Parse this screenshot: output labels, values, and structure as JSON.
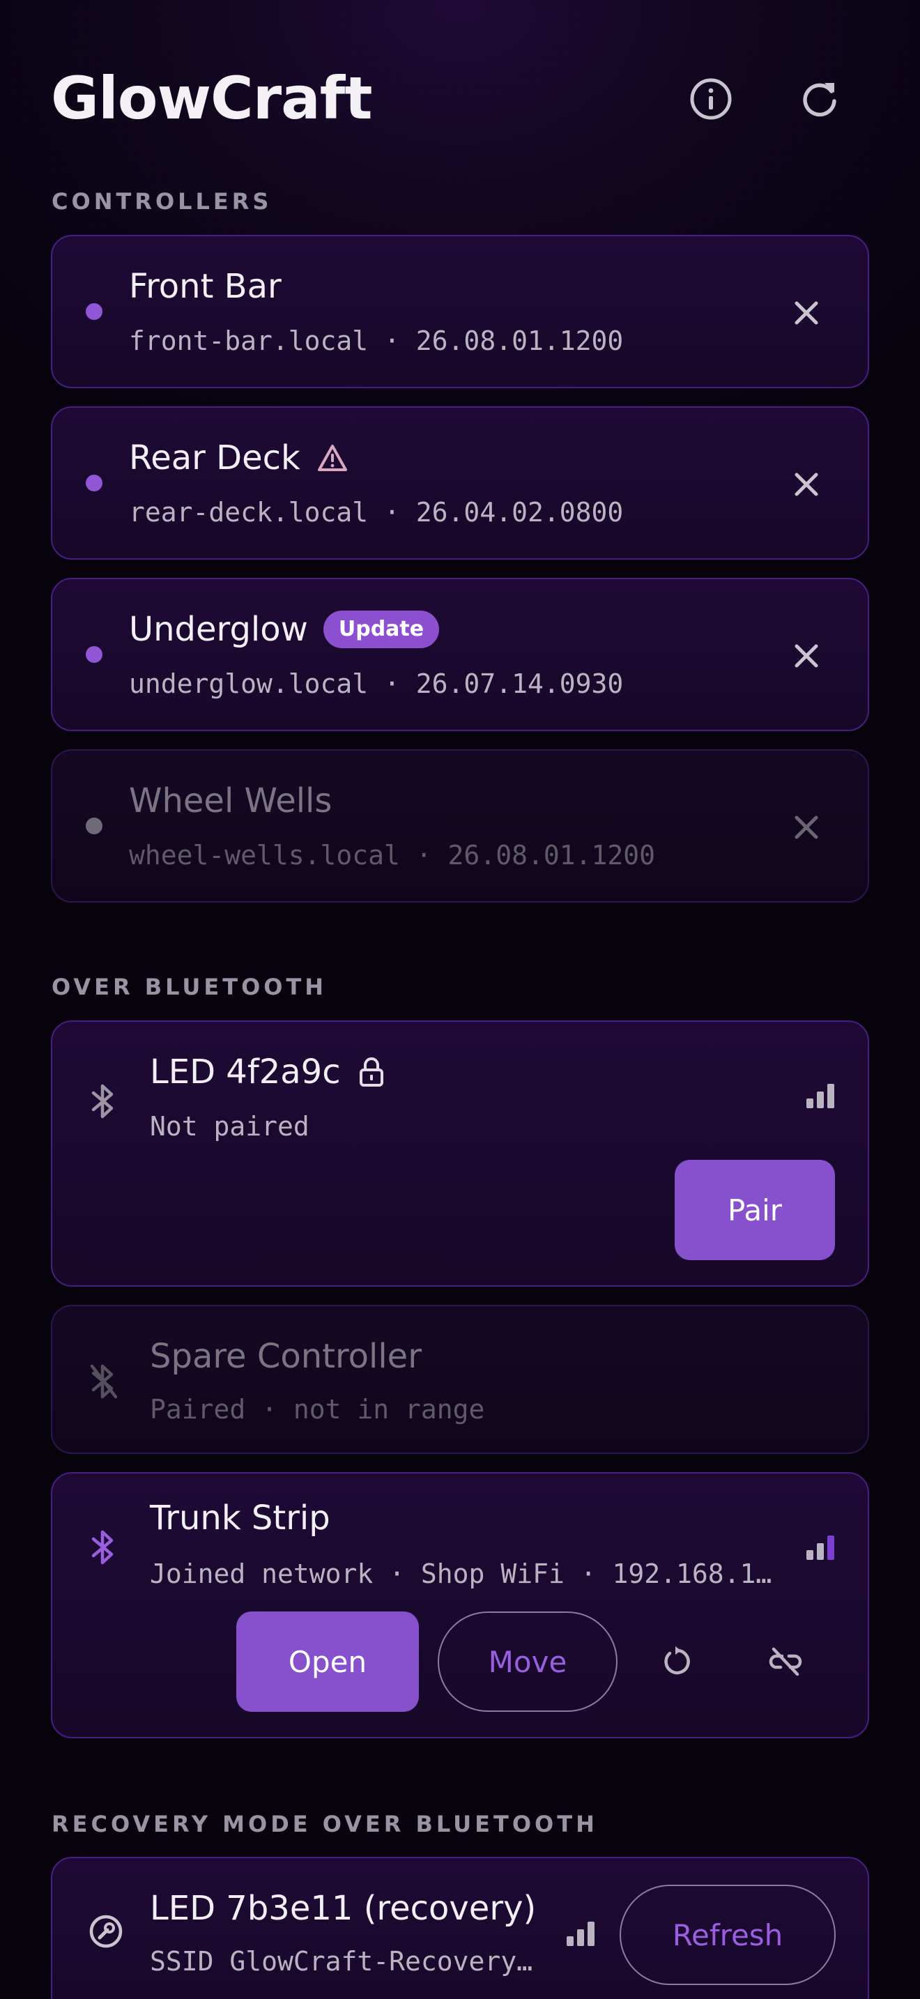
{
  "app": {
    "title": "GlowCraft"
  },
  "header": {
    "info_icon": "info-icon",
    "refresh_icon": "refresh-icon"
  },
  "sections": {
    "controllers": "CONTROLLERS",
    "bluetooth": "OVER BLUETOOTH",
    "recovery": "RECOVERY MODE OVER BLUETOOTH"
  },
  "controllers": [
    {
      "name": "Front Bar",
      "host": "front-bar.local",
      "version": "26.08.01.1200",
      "subtitle": "front-bar.local · 26.08.01.1200",
      "status": "online",
      "warning": false,
      "badge": ""
    },
    {
      "name": "Rear Deck",
      "host": "rear-deck.local",
      "version": "26.04.02.0800",
      "subtitle": "rear-deck.local · 26.04.02.0800",
      "status": "online",
      "warning": true,
      "badge": ""
    },
    {
      "name": "Underglow",
      "host": "underglow.local",
      "version": "26.07.14.0930",
      "subtitle": "underglow.local · 26.07.14.0930",
      "status": "online",
      "warning": false,
      "badge": "Update"
    },
    {
      "name": "Wheel Wells",
      "host": "wheel-wells.local",
      "version": "26.08.01.1200",
      "subtitle": "wheel-wells.local · 26.08.01.1200",
      "status": "offline",
      "warning": false,
      "badge": ""
    }
  ],
  "bluetooth": [
    {
      "name": "LED 4f2a9c",
      "subtitle": "Not paired",
      "locked": true,
      "signal_bars": 3,
      "action": "Pair"
    },
    {
      "name": "Spare Controller",
      "subtitle": "Paired · not in range",
      "signal_bars": 0
    },
    {
      "name": "Trunk Strip",
      "subtitle": "Joined network · Shop WiFi · 192.168.1…",
      "signal_bars": 3,
      "open_label": "Open",
      "move_label": "Move"
    }
  ],
  "recovery": [
    {
      "name": "LED 7b3e11 (recovery)",
      "subtitle": "SSID GlowCraft-Recovery…",
      "signal_bars": 3,
      "action": "Refresh"
    }
  ],
  "colors": {
    "accent": "#8750cc",
    "dot_online": "#9056d6",
    "dot_offline": "#6f6a77",
    "warning": "#d9a7c0",
    "border": "#4a1d85"
  }
}
